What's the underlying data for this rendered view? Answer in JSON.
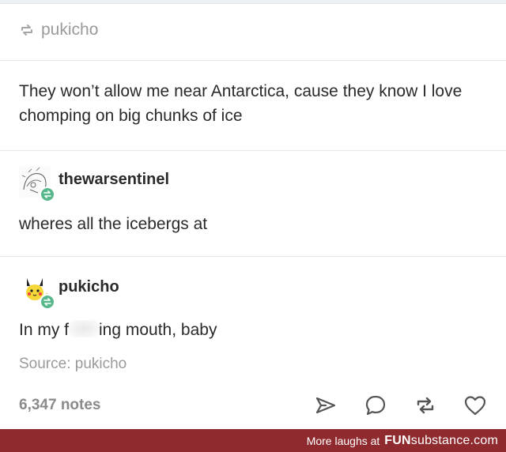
{
  "header": {
    "reblog_user": "pukicho"
  },
  "post": {
    "text": "They won’t allow me near Antarctica, cause they know I love chomping on big chunks of ice"
  },
  "reblogs": [
    {
      "username": "thewarsentinel",
      "text": "wheres all the icebergs at",
      "avatar": "sketch-avatar"
    },
    {
      "username": "pukicho",
      "text_before": "In my f",
      "text_after": "ing mouth, baby",
      "avatar": "pikachu-avatar"
    }
  ],
  "source": "Source: pukicho",
  "footer": {
    "notes": "6,347 notes",
    "actions": [
      "share-icon",
      "reply-icon",
      "reblog-icon",
      "like-icon"
    ]
  },
  "banner": {
    "more_text": "More laughs at",
    "brand_main": "FUN",
    "brand_sub": "substance.com"
  },
  "colors": {
    "reblog_badge": "#56b88c",
    "banner": "#8f2a2e",
    "muted_text": "#9a9a9a"
  }
}
